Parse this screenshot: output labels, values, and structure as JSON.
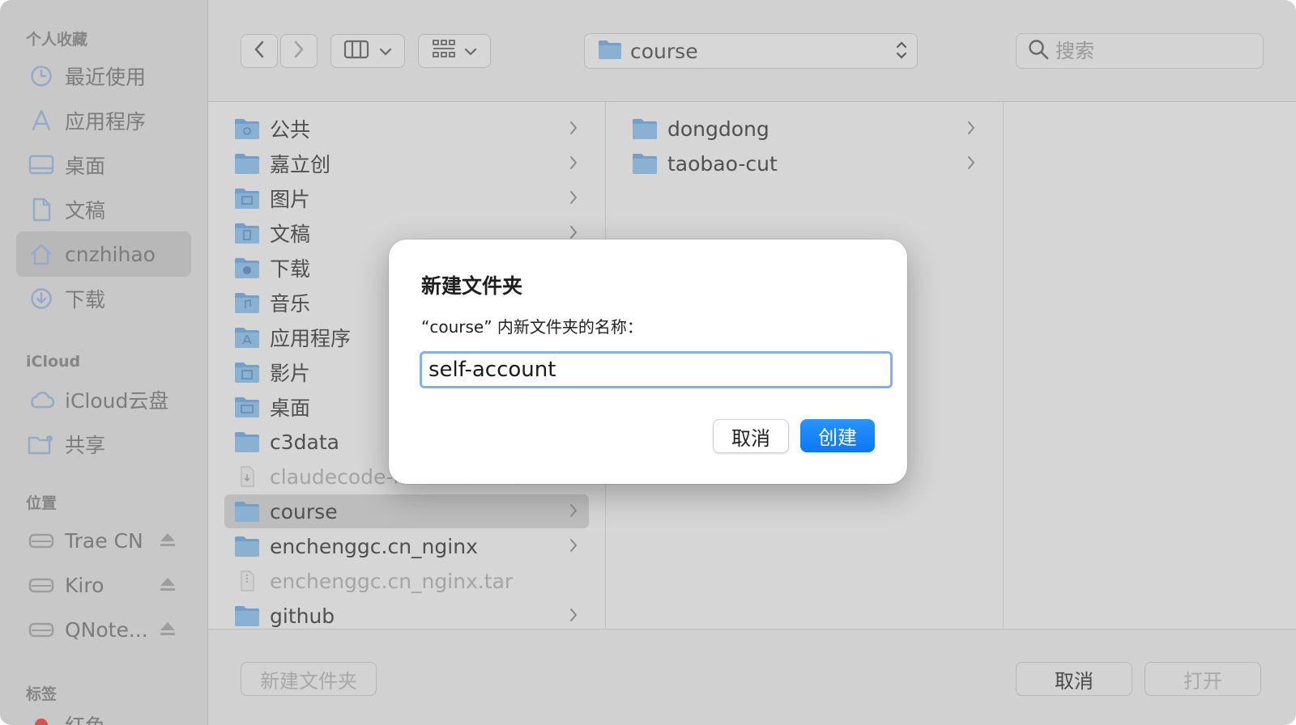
{
  "sidebar": {
    "favorites_header": "个人收藏",
    "favorites": [
      {
        "label": "最近使用",
        "icon": "clock-icon"
      },
      {
        "label": "应用程序",
        "icon": "apps-icon"
      },
      {
        "label": "桌面",
        "icon": "desktop-icon"
      },
      {
        "label": "文稿",
        "icon": "document-icon"
      },
      {
        "label": "cnzhihao",
        "icon": "home-icon",
        "selected": true
      },
      {
        "label": "下载",
        "icon": "download-icon"
      }
    ],
    "icloud_header": "iCloud",
    "icloud": [
      {
        "label": "iCloud云盘",
        "icon": "cloud-icon"
      },
      {
        "label": "共享",
        "icon": "shared-folder-icon"
      }
    ],
    "locations_header": "位置",
    "locations": [
      {
        "label": "Trae CN",
        "icon": "drive-icon"
      },
      {
        "label": "Kiro",
        "icon": "drive-icon"
      },
      {
        "label": "QNote...",
        "icon": "drive-icon"
      }
    ],
    "tags_header": "标签",
    "tags": [
      {
        "label": "红色",
        "color": "#ff5b5b"
      }
    ]
  },
  "toolbar": {
    "path_label": "course",
    "search_placeholder": "搜索"
  },
  "column1": [
    {
      "label": "公共",
      "icon": "public-folder-icon",
      "chevron": true
    },
    {
      "label": "嘉立创",
      "icon": "folder-icon",
      "chevron": true
    },
    {
      "label": "图片",
      "icon": "pictures-folder-icon",
      "chevron": true
    },
    {
      "label": "文稿",
      "icon": "documents-folder-icon",
      "chevron": true
    },
    {
      "label": "下载",
      "icon": "downloads-folder-icon",
      "chevron": false
    },
    {
      "label": "音乐",
      "icon": "music-folder-icon",
      "chevron": false
    },
    {
      "label": "应用程序",
      "icon": "applications-folder-icon",
      "chevron": false
    },
    {
      "label": "影片",
      "icon": "movies-folder-icon",
      "chevron": false
    },
    {
      "label": "桌面",
      "icon": "desktop-folder-icon",
      "chevron": false
    },
    {
      "label": "c3data",
      "icon": "folder-icon",
      "chevron": false
    },
    {
      "label": "claudecode-r...114-32-48.md",
      "icon": "file-icon",
      "chevron": false,
      "dim": true
    },
    {
      "label": "course",
      "icon": "folder-icon",
      "chevron": true,
      "selected": true
    },
    {
      "label": "enchenggc.cn_nginx",
      "icon": "folder-icon",
      "chevron": true
    },
    {
      "label": "enchenggc.cn_nginx.tar",
      "icon": "archive-file-icon",
      "chevron": false,
      "dim": true
    },
    {
      "label": "github",
      "icon": "folder-icon",
      "chevron": true
    }
  ],
  "column2": [
    {
      "label": "dongdong",
      "icon": "folder-icon",
      "chevron": true
    },
    {
      "label": "taobao-cut",
      "icon": "folder-icon",
      "chevron": true
    }
  ],
  "bottom": {
    "new_folder": "新建文件夹",
    "cancel": "取消",
    "open": "打开"
  },
  "dialog": {
    "title": "新建文件夹",
    "prompt": "“course” 内新文件夹的名称：",
    "input_value": "self-account",
    "cancel": "取消",
    "create": "创建"
  },
  "colors": {
    "accent": "#0a78f6",
    "folder": "#83b8e8",
    "focus_ring": "#86adf0"
  }
}
